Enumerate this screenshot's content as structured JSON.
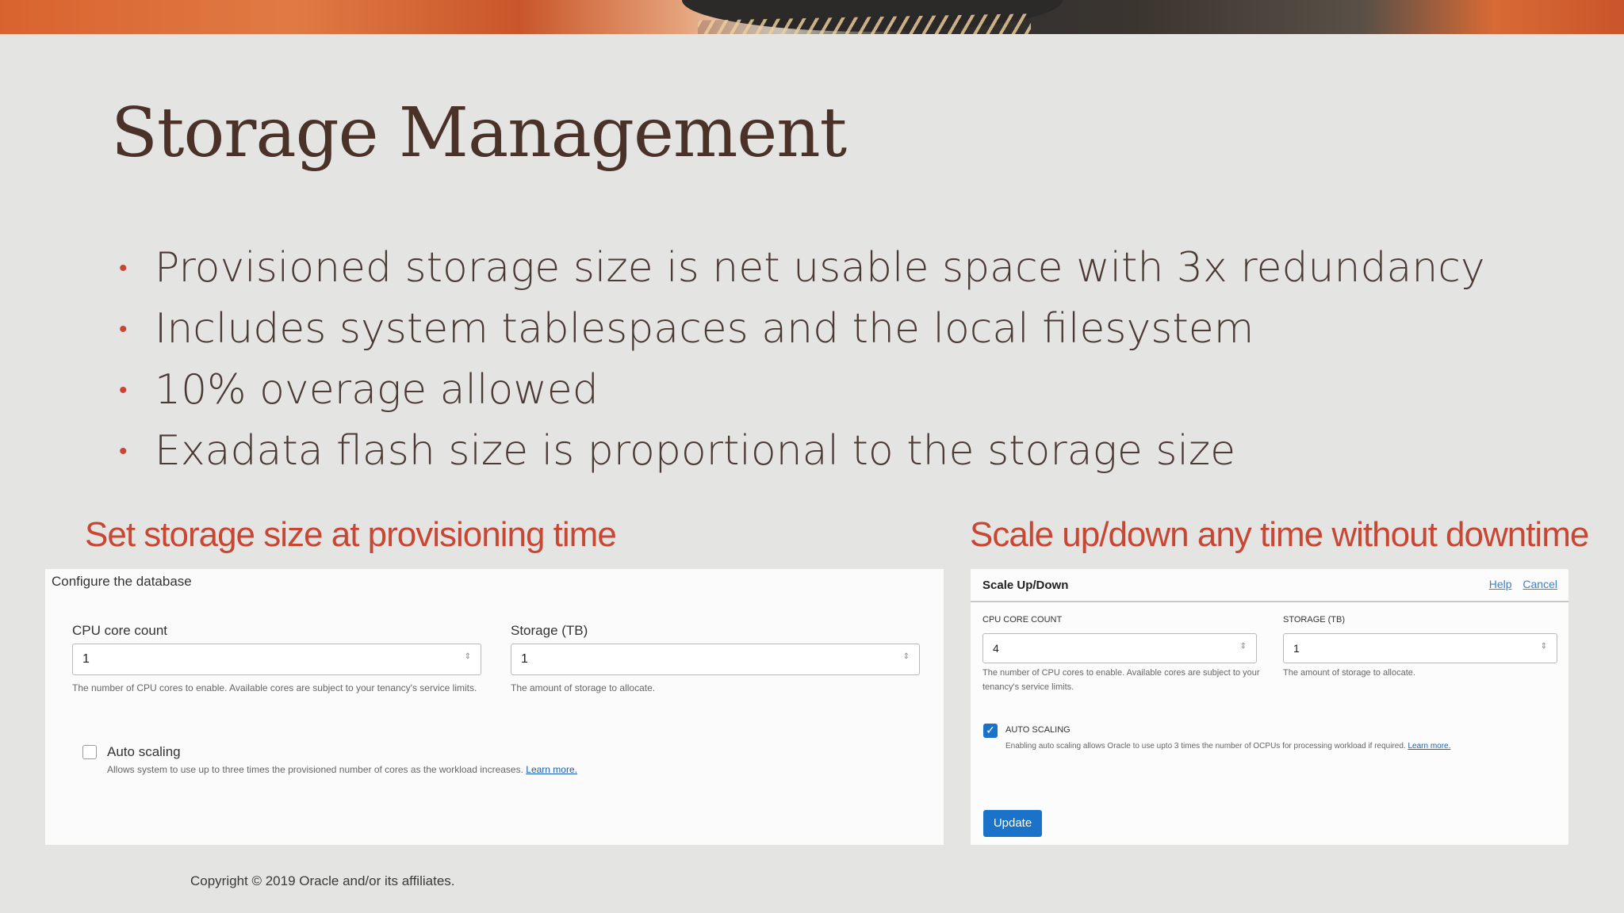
{
  "slide": {
    "title": "Storage Management",
    "bullets": [
      "Provisioned storage size is net usable space with 3x redundancy",
      "Includes system tablespaces and the local filesystem",
      "10% overage allowed",
      "Exadata flash size is proportional to the storage size"
    ],
    "bullet_glyph": "•",
    "left_heading": "Set storage size at provisioning time",
    "right_heading": "Scale up/down any time without downtime",
    "copyright": "Copyright © 2019 Oracle and/or its affiliates.",
    "accent_color": "#c74634"
  },
  "configure_panel": {
    "header": "Configure the database",
    "cpu_label": "CPU core count",
    "cpu_value": "1",
    "cpu_help": "The number of CPU cores to enable. Available cores are subject to your tenancy's service limits.",
    "storage_label": "Storage (TB)",
    "storage_value": "1",
    "storage_help": "The amount of storage to allocate.",
    "autoscale_label": "Auto scaling",
    "autoscale_help": "Allows system to use up to three times the provisioned number of cores as the workload increases.",
    "learn_more": "Learn more.",
    "autoscale_checked": false
  },
  "scale_panel": {
    "header": "Scale Up/Down",
    "help_link": "Help",
    "cancel_link": "Cancel",
    "cpu_label": "CPU CORE COUNT",
    "cpu_value": "4",
    "cpu_help": "The number of CPU cores to enable. Available cores are subject to your tenancy's service limits.",
    "storage_label": "STORAGE (TB)",
    "storage_value": "1",
    "storage_help": "The amount of storage to allocate.",
    "autoscale_label": "AUTO SCALING",
    "autoscale_help": "Enabling auto scaling allows Oracle to use upto 3 times the number of OCPUs for processing workload if required.",
    "learn_more": "Learn more.",
    "autoscale_checked": true,
    "update_button": "Update"
  },
  "icons": {
    "spinner": "⇕",
    "check": "✓"
  }
}
